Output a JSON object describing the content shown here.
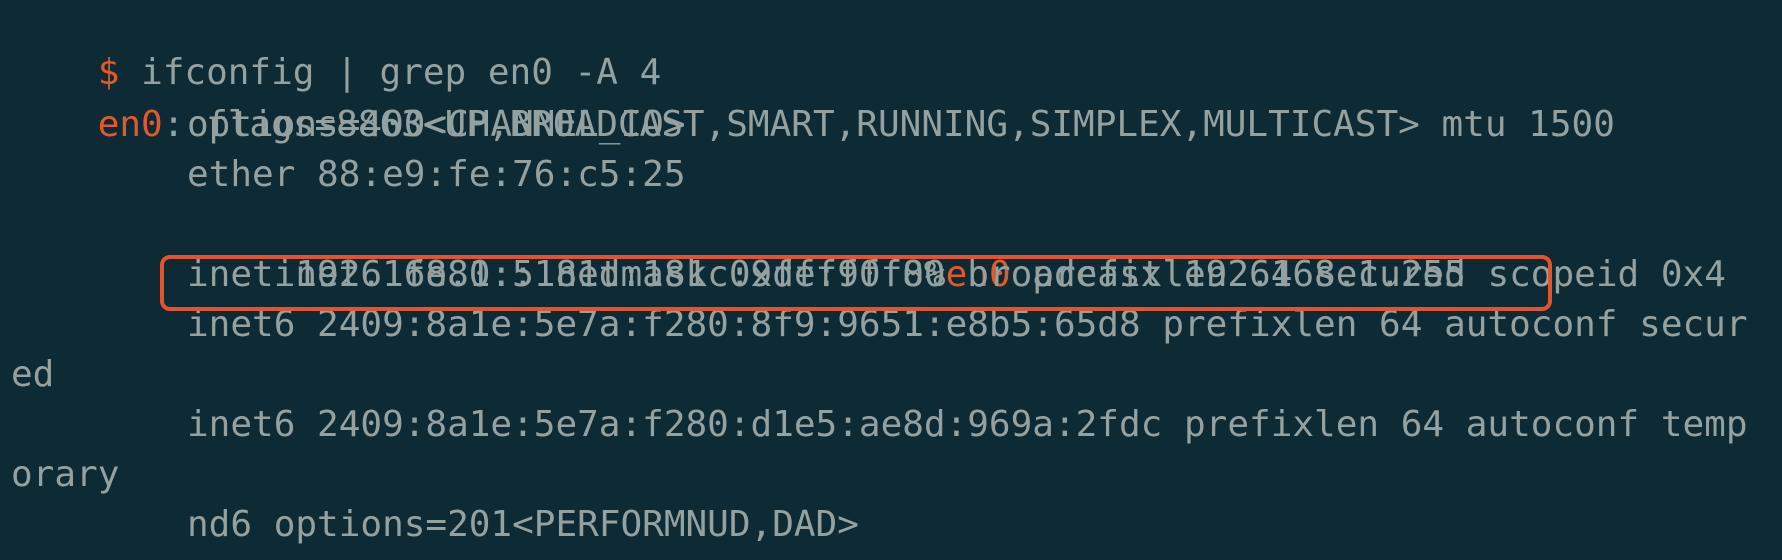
{
  "terminal": {
    "top_partial": "   ",
    "prompt_symbol": "$",
    "command": " ifconfig | grep en0 -A 4",
    "iface_name": "en0",
    "iface_rest": ": flags=8863<UP,BROADCAST,SMART,RUNNING,SIMPLEX,MULTICAST> mtu 1500",
    "options_line": "options=400<CHANNEL_IO>",
    "ether_line": "ether 88:e9:fe:76:c5:25",
    "inet6_link_pre": "inet6 fe80::181d:181c:9de:90f8%",
    "inet6_link_iface": "en0",
    "inet6_link_post": " prefixlen 64 secured scopeid 0x4",
    "inet_line": "inet 192.168.1.5 netmask 0xffffff00 broadcast 192.168.1.255",
    "inet6_secured_line": "inet6 2409:8a1e:5e7a:f280:8f9:9651:e8b5:65d8 prefixlen 64 autoconf secur",
    "inet6_secured_wrap": "ed",
    "inet6_temp_line": "inet6 2409:8a1e:5e7a:f280:d1e5:ae8d:969a:2fdc prefixlen 64 autoconf temp",
    "inet6_temp_wrap": "orary",
    "nd6_line": "nd6 options=201<PERFORMNUD,DAD>"
  },
  "colors": {
    "background": "#0e2a35",
    "text": "#93a1a1",
    "accent": "#e05a2b",
    "highlight": "#e5532a"
  }
}
